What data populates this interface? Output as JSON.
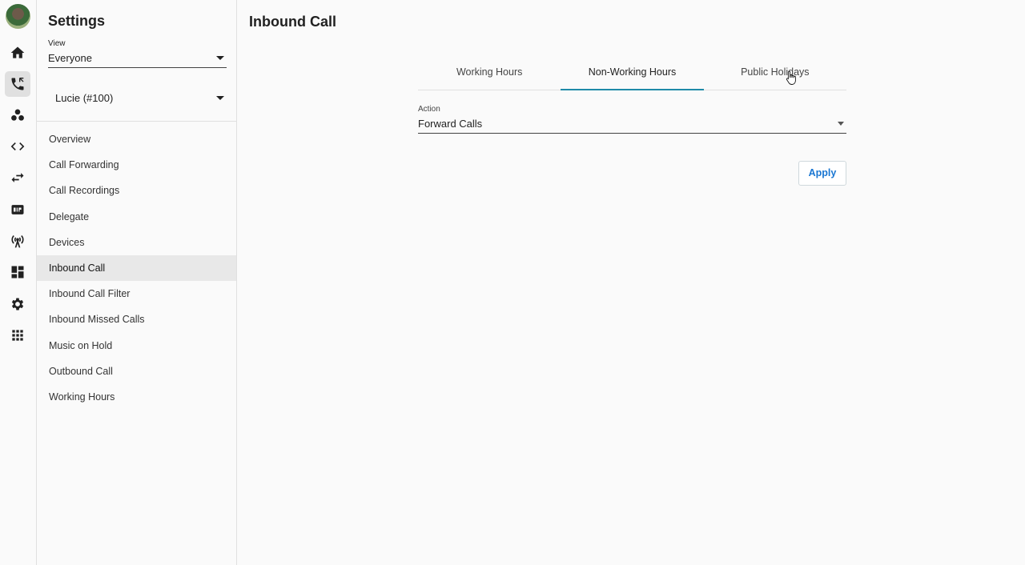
{
  "rail": {
    "icons": [
      "home-icon",
      "phone-icon",
      "contacts-icon",
      "code-icon",
      "transfer-icon",
      "sip-icon",
      "antenna-icon",
      "dashboard-icon",
      "gear-icon",
      "apps-grid-icon"
    ]
  },
  "sidebar": {
    "title": "Settings",
    "view_label": "View",
    "view_value": "Everyone",
    "user_value": "Lucie (#100)",
    "items": [
      {
        "label": "Overview"
      },
      {
        "label": "Call Forwarding"
      },
      {
        "label": "Call Recordings"
      },
      {
        "label": "Delegate"
      },
      {
        "label": "Devices"
      },
      {
        "label": "Inbound Call"
      },
      {
        "label": "Inbound Call Filter"
      },
      {
        "label": "Inbound Missed Calls"
      },
      {
        "label": "Music on Hold"
      },
      {
        "label": "Outbound Call"
      },
      {
        "label": "Working Hours"
      }
    ],
    "active_item": "Inbound Call"
  },
  "main": {
    "title": "Inbound Call",
    "tabs": [
      {
        "label": "Working Hours"
      },
      {
        "label": "Non-Working Hours"
      },
      {
        "label": "Public Holidays"
      }
    ],
    "active_tab": "Non-Working Hours",
    "action_label": "Action",
    "action_value": "Forward Calls",
    "apply_label": "Apply"
  },
  "colors": {
    "accent_tab": "#1e8aa8",
    "apply_text": "#1976d2",
    "active_item_bg": "#e8e8e8"
  }
}
